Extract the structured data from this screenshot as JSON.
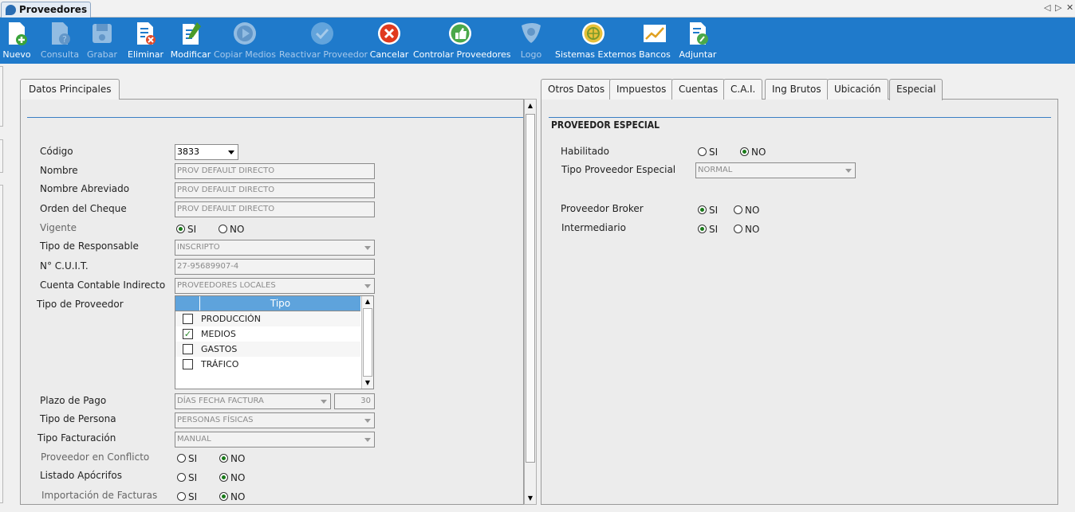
{
  "window": {
    "tab_title": "Proveedores",
    "nav_prev": "◁",
    "nav_next": "▷",
    "close": "✕"
  },
  "toolbar": [
    {
      "label": "Nuevo",
      "icon": "new-doc-icon",
      "enabled": true
    },
    {
      "label": "Consulta",
      "icon": "query-doc-icon",
      "enabled": false
    },
    {
      "label": "Grabar",
      "icon": "save-icon",
      "enabled": false
    },
    {
      "label": "Eliminar",
      "icon": "delete-doc-icon",
      "enabled": true
    },
    {
      "label": "Modificar",
      "icon": "edit-doc-icon",
      "enabled": true
    },
    {
      "label": "Copiar Medios",
      "icon": "play-icon",
      "enabled": false
    },
    {
      "label": "Reactivar Proveedor",
      "icon": "check-circle-icon",
      "enabled": false
    },
    {
      "label": "Cancelar",
      "icon": "cancel-icon",
      "enabled": true
    },
    {
      "label": "Controlar Proveedores",
      "icon": "thumbs-up-icon",
      "enabled": true
    },
    {
      "label": "Logo",
      "icon": "logo-icon",
      "enabled": false
    },
    {
      "label": "Sistemas Externos",
      "icon": "external-systems-icon",
      "enabled": true
    },
    {
      "label": "Bancos",
      "icon": "chart-icon",
      "enabled": true
    },
    {
      "label": "Adjuntar",
      "icon": "attach-icon",
      "enabled": true
    }
  ],
  "left": {
    "tab": "Datos Principales",
    "codigo": {
      "label": "Código",
      "value": "3833"
    },
    "nombre": {
      "label": "Nombre",
      "value": "PROV DEFAULT DIRECTO"
    },
    "nombre_abreviado": {
      "label": "Nombre Abreviado",
      "value": "PROV DEFAULT DIRECTO"
    },
    "orden_cheque": {
      "label": "Orden del Cheque",
      "value": "PROV DEFAULT DIRECTO"
    },
    "vigente": {
      "label": "Vigente",
      "si": "SI",
      "no": "NO",
      "selected": "SI"
    },
    "tipo_responsable": {
      "label": "Tipo de Responsable",
      "value": "INSCRIPTO"
    },
    "cuit": {
      "label": "N° C.U.I.T.",
      "value": "27-95689907-4"
    },
    "cuenta_contable": {
      "label": "Cuenta Contable Indirecto",
      "value": "PROVEEDORES LOCALES"
    },
    "tipo_proveedor": {
      "label": "Tipo de Proveedor",
      "column": "Tipo",
      "rows": [
        {
          "name": "PRODUCCIÓN",
          "checked": false
        },
        {
          "name": "MEDIOS",
          "checked": true
        },
        {
          "name": "GASTOS",
          "checked": false
        },
        {
          "name": "TRÁFICO",
          "checked": false
        }
      ]
    },
    "plazo_pago": {
      "label": "Plazo de Pago",
      "value": "DÍAS FECHA FACTURA",
      "days": "30"
    },
    "tipo_persona": {
      "label": "Tipo de Persona",
      "value": "PERSONAS FÍSICAS"
    },
    "tipo_facturacion": {
      "label": "Tipo Facturación",
      "value": "MANUAL"
    },
    "conflicto": {
      "label": "Proveedor en Conflicto",
      "si": "SI",
      "no": "NO",
      "selected": "NO"
    },
    "apocrifos": {
      "label": "Listado Apócrifos",
      "si": "SI",
      "no": "NO",
      "selected": "NO"
    },
    "importacion": {
      "label": "Importación de Facturas",
      "si": "SI",
      "no": "NO",
      "selected": "NO"
    }
  },
  "right": {
    "tabs": [
      "Otros Datos",
      "Impuestos",
      "Cuentas",
      "C.A.I.",
      "Ing Brutos",
      "Ubicación",
      "Especial"
    ],
    "active_tab": "Especial",
    "section_title": "PROVEEDOR ESPECIAL",
    "habilitado": {
      "label": "Habilitado",
      "si": "SI",
      "no": "NO",
      "selected": "NO"
    },
    "tipo_especial": {
      "label": "Tipo Proveedor Especial",
      "value": "NORMAL"
    },
    "broker": {
      "label": "Proveedor Broker",
      "si": "SI",
      "no": "NO",
      "selected": "SI"
    },
    "intermediario": {
      "label": "Intermediario",
      "si": "SI",
      "no": "NO",
      "selected": "SI"
    }
  },
  "colors": {
    "toolbar_bg": "#1f7acb",
    "section_line": "#3a7fc4",
    "grid_header": "#5ea3dc"
  }
}
